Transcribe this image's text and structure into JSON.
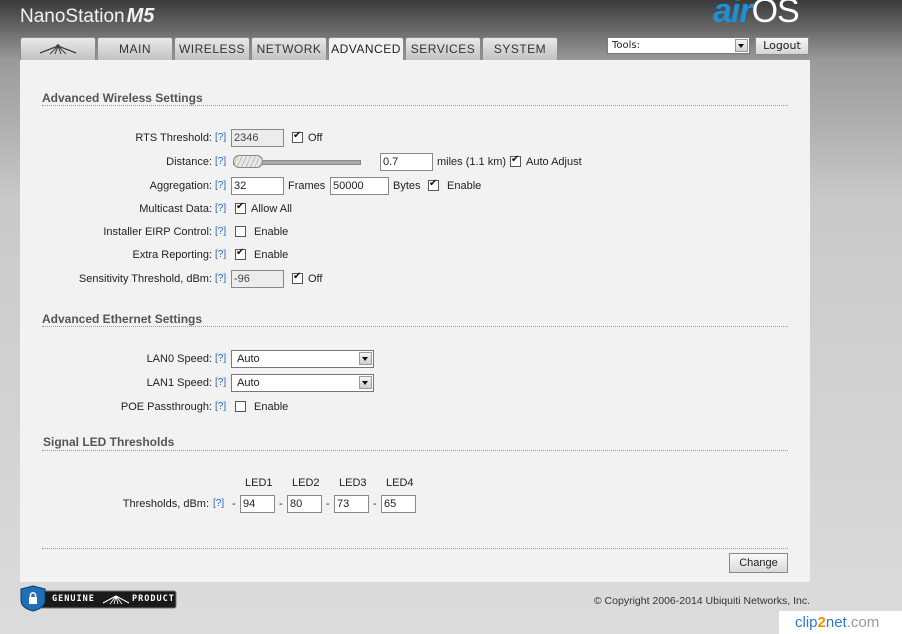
{
  "header": {
    "product": "NanoStation",
    "model": "M5",
    "logo_air": "air",
    "logo_os": "OS",
    "tabs": [
      "MAIN",
      "WIRELESS",
      "NETWORK",
      "ADVANCED",
      "SERVICES",
      "SYSTEM"
    ],
    "active_tab": "ADVANCED",
    "tools_select": "Tools:",
    "logout": "Logout"
  },
  "help_marker": "[?]",
  "wireless": {
    "title": "Advanced Wireless Settings",
    "rts_label": "RTS Threshold:",
    "rts_value": "2346",
    "rts_off": "Off",
    "distance_label": "Distance:",
    "distance_value": "0.7",
    "distance_unit": "miles (1.1 km)",
    "auto_adjust": "Auto Adjust",
    "aggregation_label": "Aggregation:",
    "frames_value": "32",
    "frames_label": "Frames",
    "bytes_value": "50000",
    "bytes_label": "Bytes",
    "enable": "Enable",
    "multicast_label": "Multicast Data:",
    "allow_all": "Allow All",
    "eirp_label": "Installer EIRP Control:",
    "extra_label": "Extra Reporting:",
    "sens_label": "Sensitivity Threshold, dBm:",
    "sens_value": "-96",
    "sens_off": "Off"
  },
  "ethernet": {
    "title": "Advanced Ethernet Settings",
    "lan0_label": "LAN0 Speed:",
    "lan0_value": "Auto",
    "lan1_label": "LAN1 Speed:",
    "lan1_value": "Auto",
    "poe_label": "POE Passthrough:",
    "enable": "Enable"
  },
  "led": {
    "title": "Signal LED Thresholds",
    "headers": [
      "LED1",
      "LED2",
      "LED3",
      "LED4"
    ],
    "label": "Thresholds, dBm:",
    "dash": "-",
    "values": [
      "94",
      "80",
      "73",
      "65"
    ]
  },
  "change_button": "Change",
  "footer": {
    "badge_left": "GENUINE",
    "badge_right": "PRODUCT",
    "copyright": "© Copyright 2006-2014 Ubiquiti Networks, Inc.",
    "watermark_a": "clip",
    "watermark_b": "2",
    "watermark_c": "net",
    "watermark_d": ".com"
  },
  "colors": {
    "link": "#2266bb",
    "air": "#1f8fd6",
    "panel": "#f2f2f2"
  }
}
